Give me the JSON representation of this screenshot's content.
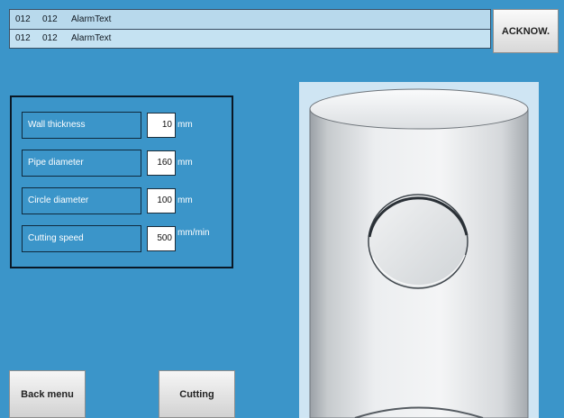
{
  "alarms": [
    {
      "code1": "012",
      "code2": "012",
      "text": "AlarmText"
    },
    {
      "code1": "012",
      "code2": "012",
      "text": "AlarmText"
    }
  ],
  "ack_button": "ACKNOW.",
  "parameters": [
    {
      "label": "Wall thickness",
      "value": "10",
      "unit": "mm"
    },
    {
      "label": "Pipe diameter",
      "value": "160",
      "unit": "mm"
    },
    {
      "label": "Circle diameter",
      "value": "100",
      "unit": "mm"
    },
    {
      "label": "Cutting speed",
      "value": "500",
      "unit": "mm/min"
    }
  ],
  "buttons": {
    "back": "Back menu",
    "cutting": "Cutting"
  },
  "colors": {
    "background": "#3b95c9",
    "alarm_bar": "#c5e2f2",
    "pipe_surface": "#e4e6e9"
  },
  "icons": {
    "pipe": "pipe-with-circle-cutout-graphic"
  }
}
